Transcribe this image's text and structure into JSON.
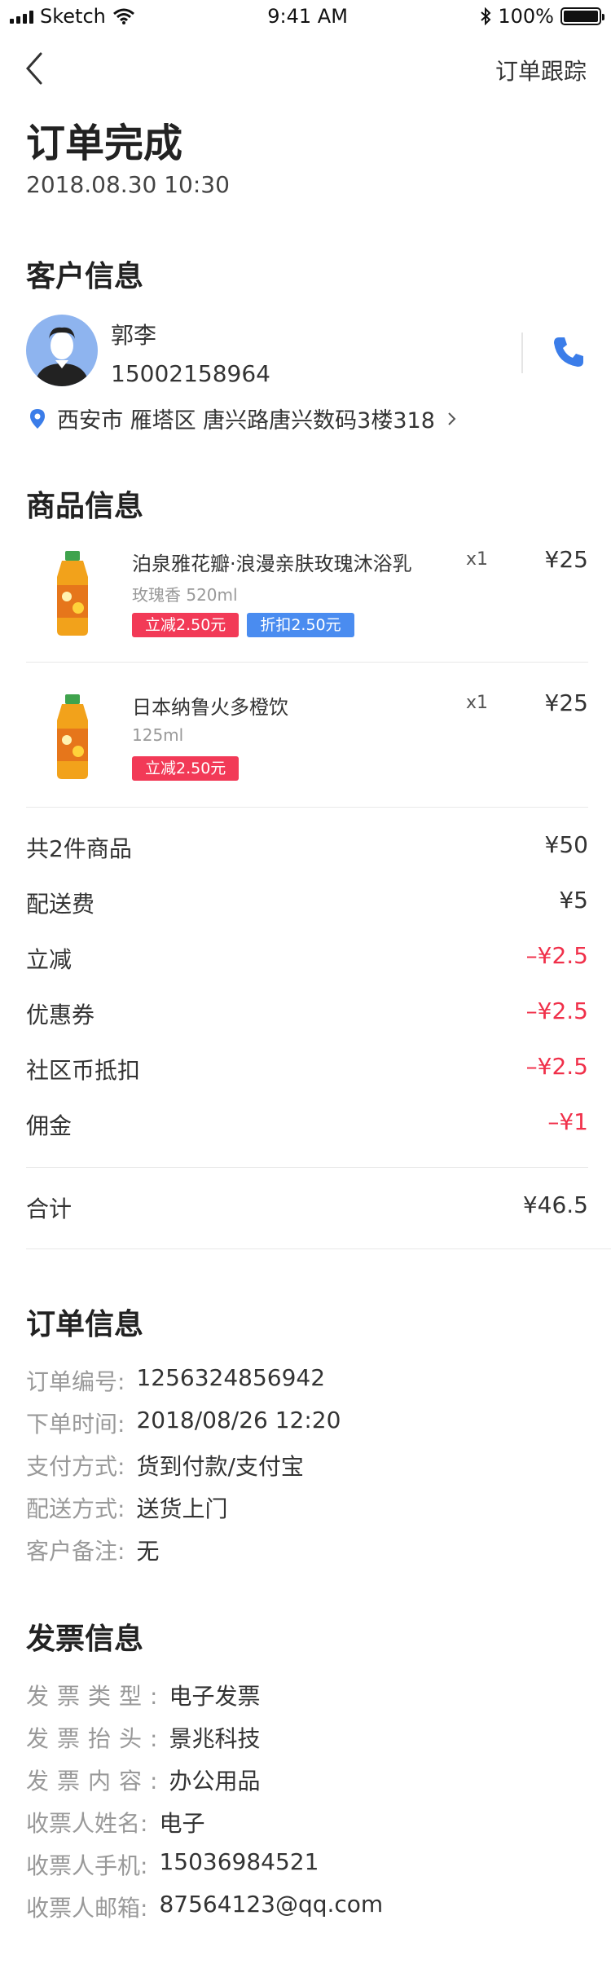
{
  "status_bar": {
    "carrier": "Sketch",
    "time": "9:41 AM",
    "battery_text": "100%",
    "battery_level": 1.0
  },
  "nav": {
    "track_label": "订单跟踪"
  },
  "header": {
    "title": "订单完成",
    "datetime": "2018.08.30 10:30"
  },
  "customer": {
    "section_title": "客户信息",
    "name": "郭李",
    "phone": "15002158964",
    "address": "西安市 雁塔区 唐兴路唐兴数码3楼318"
  },
  "goods": {
    "section_title": "商品信息",
    "items": [
      {
        "name": "泊泉雅花瓣·浪漫亲肤玫瑰沐浴乳",
        "spec": "玫瑰香 520ml",
        "qty": "x1",
        "price": "¥25",
        "tags": [
          "立减2.50元",
          "折扣2.50元"
        ]
      },
      {
        "name": "日本纳鲁火多橙饮",
        "spec": "125ml",
        "qty": "x1",
        "price": "¥25",
        "tags": [
          "立减2.50元"
        ]
      }
    ]
  },
  "fees": [
    {
      "label": "共2件商品",
      "value": "¥50",
      "negative": false
    },
    {
      "label": "配送费",
      "value": "¥5",
      "negative": false
    },
    {
      "label": "立减",
      "value": "–¥2.5",
      "negative": true
    },
    {
      "label": "优惠券",
      "value": "–¥2.5",
      "negative": true
    },
    {
      "label": "社区币抵扣",
      "value": "–¥2.5",
      "negative": true
    },
    {
      "label": "佣金",
      "value": "–¥1",
      "negative": true
    }
  ],
  "total": {
    "label": "合计",
    "value": "¥46.5"
  },
  "order_info": {
    "section_title": "订单信息",
    "rows": [
      {
        "label": "订单编号:",
        "value": "1256324856942"
      },
      {
        "label": "下单时间:",
        "value": "2018/08/26 12:20"
      },
      {
        "label": "支付方式:",
        "value": "货到付款/支付宝"
      },
      {
        "label": "配送方式:",
        "value": "送货上门"
      },
      {
        "label": "客户备注:",
        "value": "无"
      }
    ]
  },
  "invoice_info": {
    "section_title": "发票信息",
    "rows": [
      {
        "label": "发票类型:",
        "value": "电子发票"
      },
      {
        "label": "发票抬头:",
        "value": "景兆科技"
      },
      {
        "label": "发票内容:",
        "value": "办公用品"
      },
      {
        "label": "收票人姓名:",
        "value": "电子"
      },
      {
        "label": "收票人手机:",
        "value": "15036984521"
      },
      {
        "label": "收票人邮箱:",
        "value": "87564123@qq.com"
      }
    ]
  },
  "colors": {
    "accent_blue": "#3b7de9",
    "negative_red": "#f0304a",
    "tag_red": "#f23a57",
    "tag_blue": "#4a8cf0"
  },
  "icons": {
    "back": "chevron-left-icon",
    "phone": "phone-icon",
    "location": "location-pin-icon"
  }
}
